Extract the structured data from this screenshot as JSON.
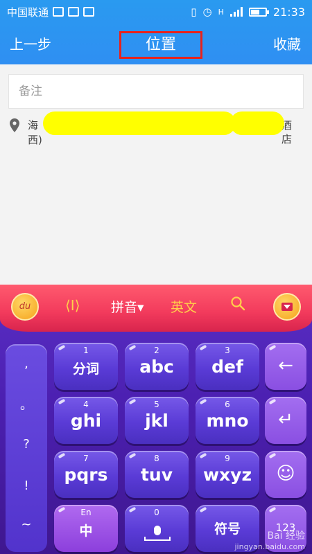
{
  "status_bar": {
    "carrier": "中国联通",
    "time": "21:33",
    "network": "H",
    "battery_level": 0.6
  },
  "title_bar": {
    "back_label": "上一步",
    "title": "位置",
    "favorite_label": "收藏"
  },
  "note": {
    "placeholder": "备注"
  },
  "location": {
    "text_start": "海",
    "text_end": "酒店",
    "text_line2": "西)"
  },
  "keyboard": {
    "logo_text": "du",
    "toolbar": {
      "pinyin_label": "拼音▾",
      "english_label": "英文"
    },
    "punctuation": [
      ",",
      "。",
      "?",
      "!",
      "~"
    ],
    "keys": [
      {
        "num": "1",
        "label": "分词"
      },
      {
        "num": "2",
        "label": "abc"
      },
      {
        "num": "3",
        "label": "def"
      },
      {
        "num": "4",
        "label": "ghi"
      },
      {
        "num": "5",
        "label": "jkl"
      },
      {
        "num": "6",
        "label": "mno"
      },
      {
        "num": "7",
        "label": "pqrs"
      },
      {
        "num": "8",
        "label": "tuv"
      },
      {
        "num": "9",
        "label": "wxyz"
      }
    ],
    "bottom": {
      "lang_top": "En",
      "lang_main": "中",
      "zero": "0",
      "symbols": "符号",
      "num_switch": "123"
    }
  },
  "watermark": {
    "brand": "Bai 经验",
    "url": "jingyan.baidu.com"
  },
  "colors": {
    "header_blue": "#2f8ff2",
    "title_highlight": "#e8221b",
    "redaction": "#ffff00",
    "keyboard_purple": "#4b1fb0",
    "toolbar_red": "#f23a5c"
  }
}
